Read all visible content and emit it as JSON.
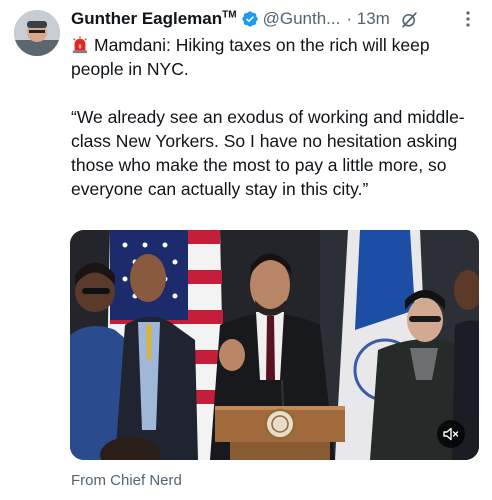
{
  "tweet": {
    "display_name": "Gunther Eagleman",
    "trademark": "TM",
    "handle": "@Gunth...",
    "separator": "·",
    "time": "13m",
    "headline": "Mamdani: Hiking taxes on the rich will keep people in NYC.",
    "quote": "“We already see an exodus of working and middle-class New Yorkers. So I have no hesitation asking those who make the most to pay a little more, so everyone can actually stay in this city.”",
    "attribution": "From Chief Nerd"
  },
  "icons": {
    "avatar": "avatar",
    "verified": "verified-badge-icon",
    "grok": "grok-icon",
    "more": "more-options-icon",
    "siren": "siren-emoji-icon",
    "mute": "muted-speaker-icon"
  },
  "colors": {
    "verified_blue": "#1d9bf0",
    "secondary_text": "#536471",
    "primary_text": "#0f1419"
  }
}
